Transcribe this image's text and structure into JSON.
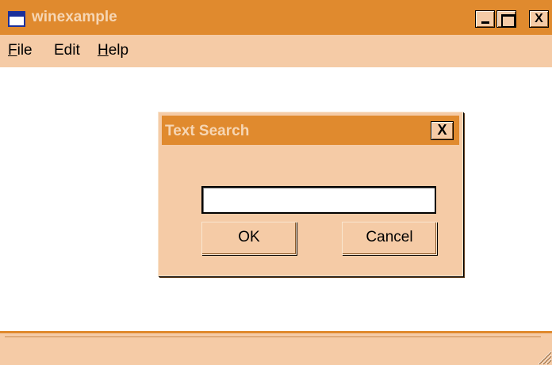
{
  "window": {
    "title": "winexample",
    "controls": {
      "minimize": "",
      "maximize": "",
      "close": "X"
    }
  },
  "menu": {
    "items": [
      {
        "label_rest": "ile",
        "mnemonic": "F"
      },
      {
        "label": "Edit"
      },
      {
        "label_rest": "elp",
        "mnemonic": "H"
      }
    ]
  },
  "dialog": {
    "title": "Text Search",
    "close_label": "X",
    "search_value": "",
    "ok_label": "OK",
    "cancel_label": "Cancel"
  },
  "status_bar": {
    "text": ""
  },
  "colors": {
    "title_active": "#e08a2e",
    "face": "#f5cba6",
    "title_text": "#f6d6b4",
    "icon_blue": "#1b2f9a"
  },
  "icons": [
    "app-icon",
    "minimize-icon",
    "maximize-icon",
    "close-icon",
    "size-grip-icon"
  ]
}
